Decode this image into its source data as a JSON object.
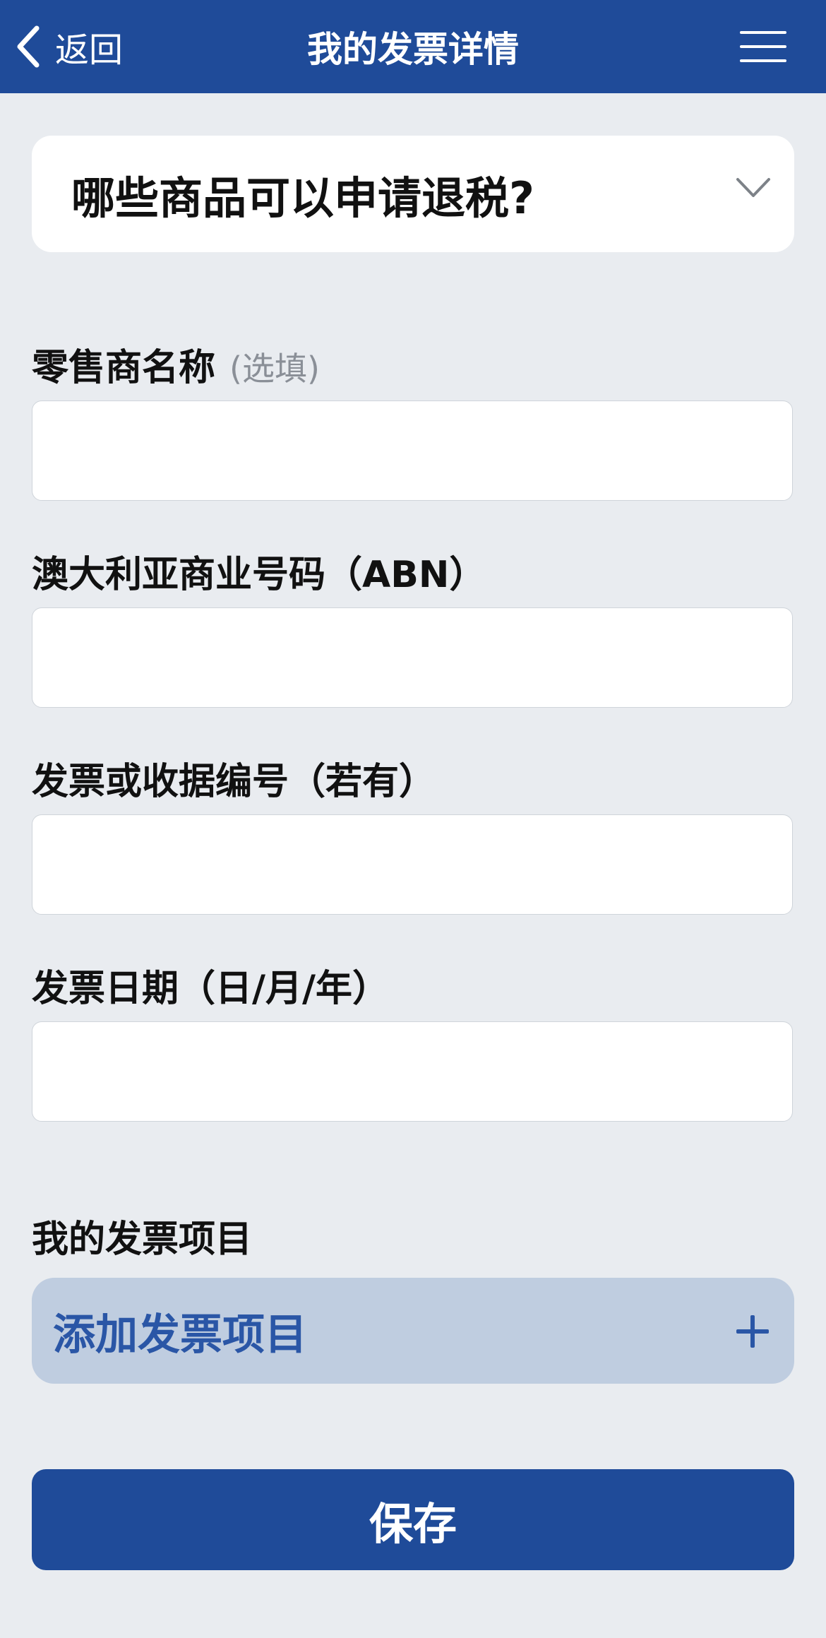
{
  "header": {
    "back_label": "返回",
    "title": "我的发票详情"
  },
  "faq": {
    "question": "哪些商品可以申请退税?"
  },
  "form": {
    "retailer_label": "零售商名称",
    "retailer_optional": "(选填)",
    "retailer_value": "",
    "abn_label": "澳大利亚商业号码（ABN）",
    "abn_value": "",
    "invoice_number_label": "发票或收据编号（若有）",
    "invoice_number_value": "",
    "invoice_date_label": "发票日期（日/月/年）",
    "invoice_date_value": ""
  },
  "items": {
    "section_title": "我的发票项目",
    "add_label": "添加发票项目"
  },
  "actions": {
    "save_label": "保存"
  },
  "colors": {
    "brand": "#1f4b99",
    "background": "#e9ecf0",
    "add_item_bg": "#bfcde0",
    "add_item_text": "#2a56a6"
  },
  "icons": {
    "back": "chevron-left-icon",
    "menu": "hamburger-menu-icon",
    "faq_toggle": "chevron-down-icon",
    "add": "plus-icon"
  }
}
